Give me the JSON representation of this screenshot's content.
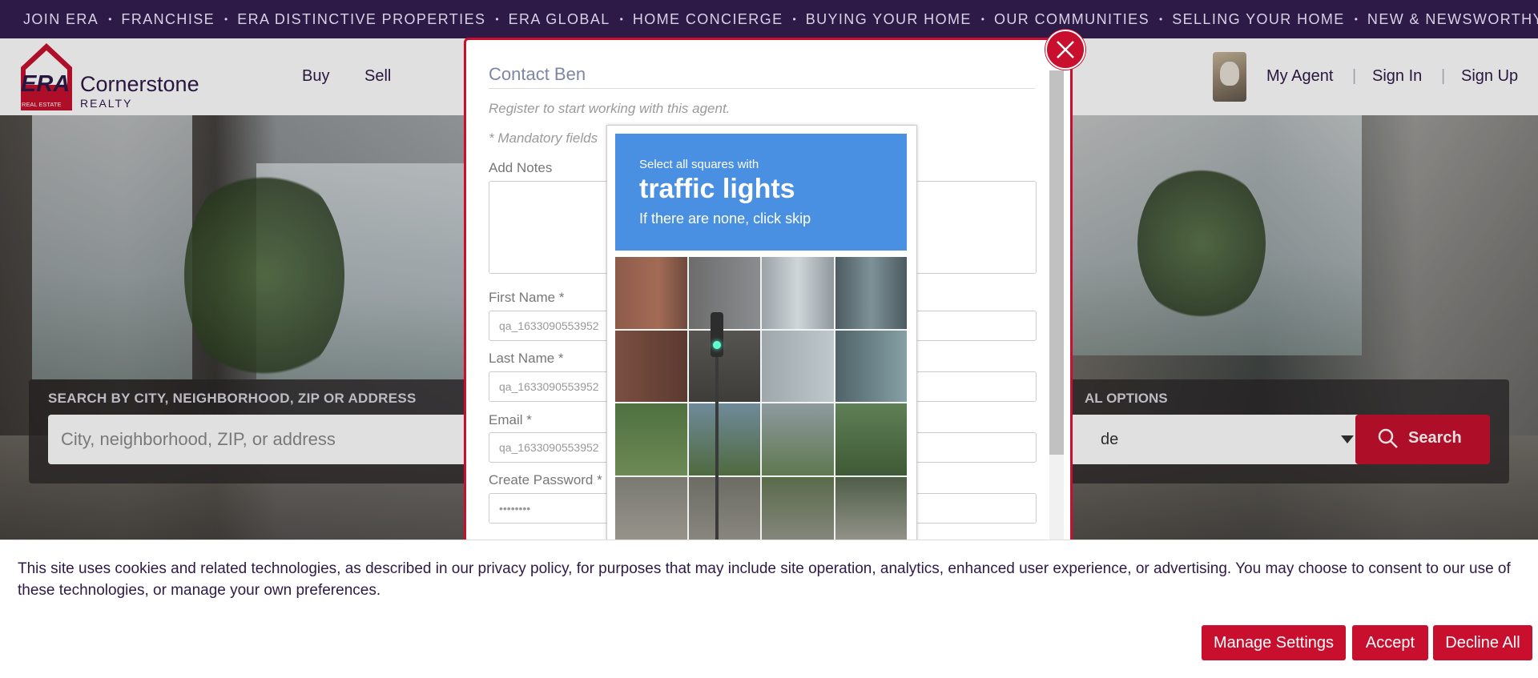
{
  "topbar": {
    "items": [
      "JOIN ERA",
      "FRANCHISE",
      "ERA DISTINCTIVE PROPERTIES",
      "ERA GLOBAL",
      "HOME CONCIERGE",
      "BUYING YOUR HOME",
      "OUR COMMUNITIES",
      "SELLING YOUR HOME",
      "NEW & NEWSWORTHY"
    ],
    "separator": "•"
  },
  "header": {
    "logo": {
      "mark": "ERA",
      "tagline": "REAL ESTATE",
      "name": "Cornerstone",
      "sub": "REALTY"
    },
    "nav": {
      "buy": "Buy",
      "sell": "Sell"
    },
    "my_agent": "My Agent",
    "sign_in": "Sign In",
    "sign_up": "Sign Up",
    "divider": "|"
  },
  "search": {
    "label": "SEARCH BY CITY, NEIGHBORHOOD, ZIP OR ADDRESS",
    "placeholder": "City, neighborhood, ZIP, or address",
    "options_label": "AL OPTIONS",
    "select_value": "de",
    "button": "Search"
  },
  "modal": {
    "title": "Contact Ben",
    "subtitle": "Register to start working with this agent.",
    "mandatory": "* Mandatory fields",
    "notes_label": "Add Notes",
    "first_name_label": "First Name *",
    "first_name_value": "qa_1633090553952",
    "last_name_label": "Last Name *",
    "last_name_value": "qa_1633090553952",
    "email_label": "Email *",
    "email_value": "qa_1633090553952",
    "password_label": "Create Password *",
    "password_value": "••••••••"
  },
  "captcha": {
    "line1": "Select all squares with",
    "line2": "traffic lights",
    "line3": "If there are none, click skip"
  },
  "cookie": {
    "text": "This site uses cookies and related technologies, as described in our privacy policy, for purposes that may include site operation, analytics, enhanced user experience, or advertising. You may choose to consent to our use of these technologies, or manage your own preferences.",
    "manage": "Manage Settings",
    "accept": "Accept",
    "decline": "Decline All"
  },
  "colors": {
    "brand_red": "#c8102e",
    "brand_purple": "#2e1a47",
    "captcha_blue": "#4a90e2"
  }
}
